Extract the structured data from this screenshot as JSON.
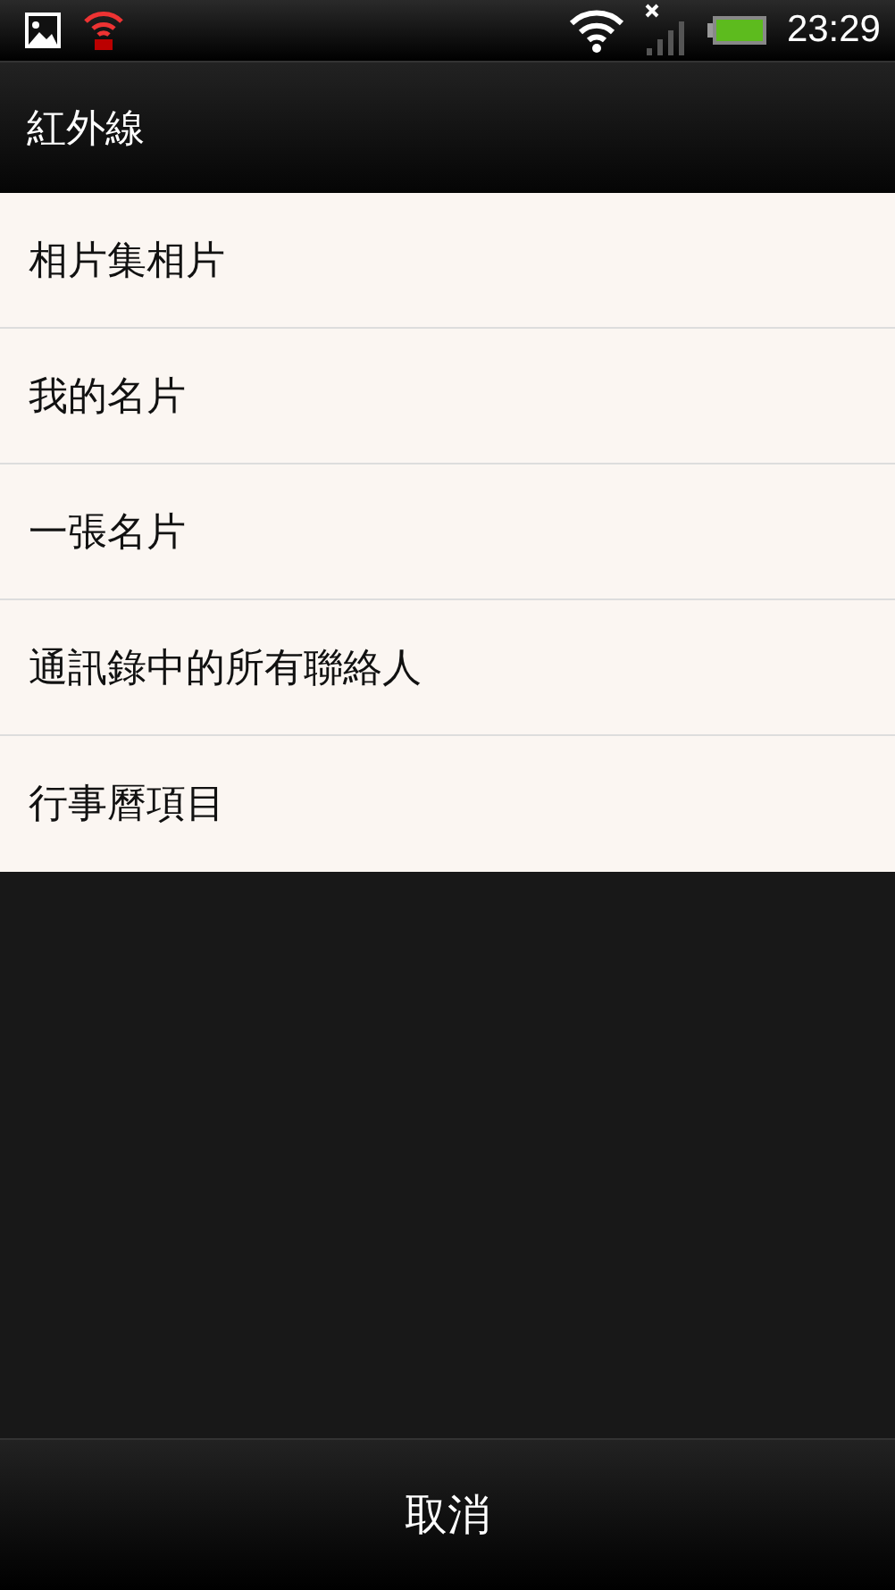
{
  "status_bar": {
    "time": "23:29"
  },
  "title": "紅外線",
  "items": [
    {
      "label": "相片集相片"
    },
    {
      "label": "我的名片"
    },
    {
      "label": "一張名片"
    },
    {
      "label": "通訊錄中的所有聯絡人"
    },
    {
      "label": "行事曆項目"
    }
  ],
  "cancel_button": "取消"
}
